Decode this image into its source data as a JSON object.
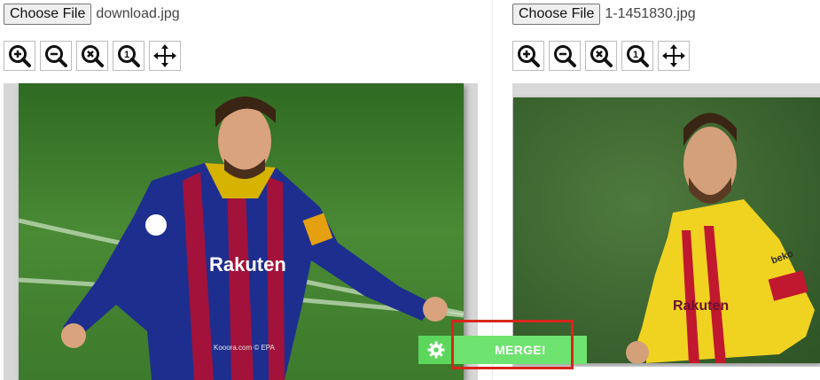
{
  "left_panel": {
    "choose_file_label": "Choose File",
    "file_name": "download.jpg",
    "tools": [
      "zoom-in-icon",
      "zoom-out-icon",
      "zoom-reset-icon",
      "zoom-actual-icon",
      "move-icon"
    ],
    "watermark": "Kooora.com © EPA"
  },
  "right_panel": {
    "choose_file_label": "Choose File",
    "file_name": "1-1451830.jpg",
    "tools": [
      "zoom-in-icon",
      "zoom-out-icon",
      "zoom-reset-icon",
      "zoom-actual-icon",
      "move-icon"
    ]
  },
  "merge": {
    "label": "MERGE!",
    "settings_icon": "gear-icon"
  },
  "colors": {
    "merge_green": "#6fe36f",
    "gear_green": "#5cd75c",
    "highlight_red": "#d8261c",
    "pitch_green": "#3f7a2e"
  }
}
